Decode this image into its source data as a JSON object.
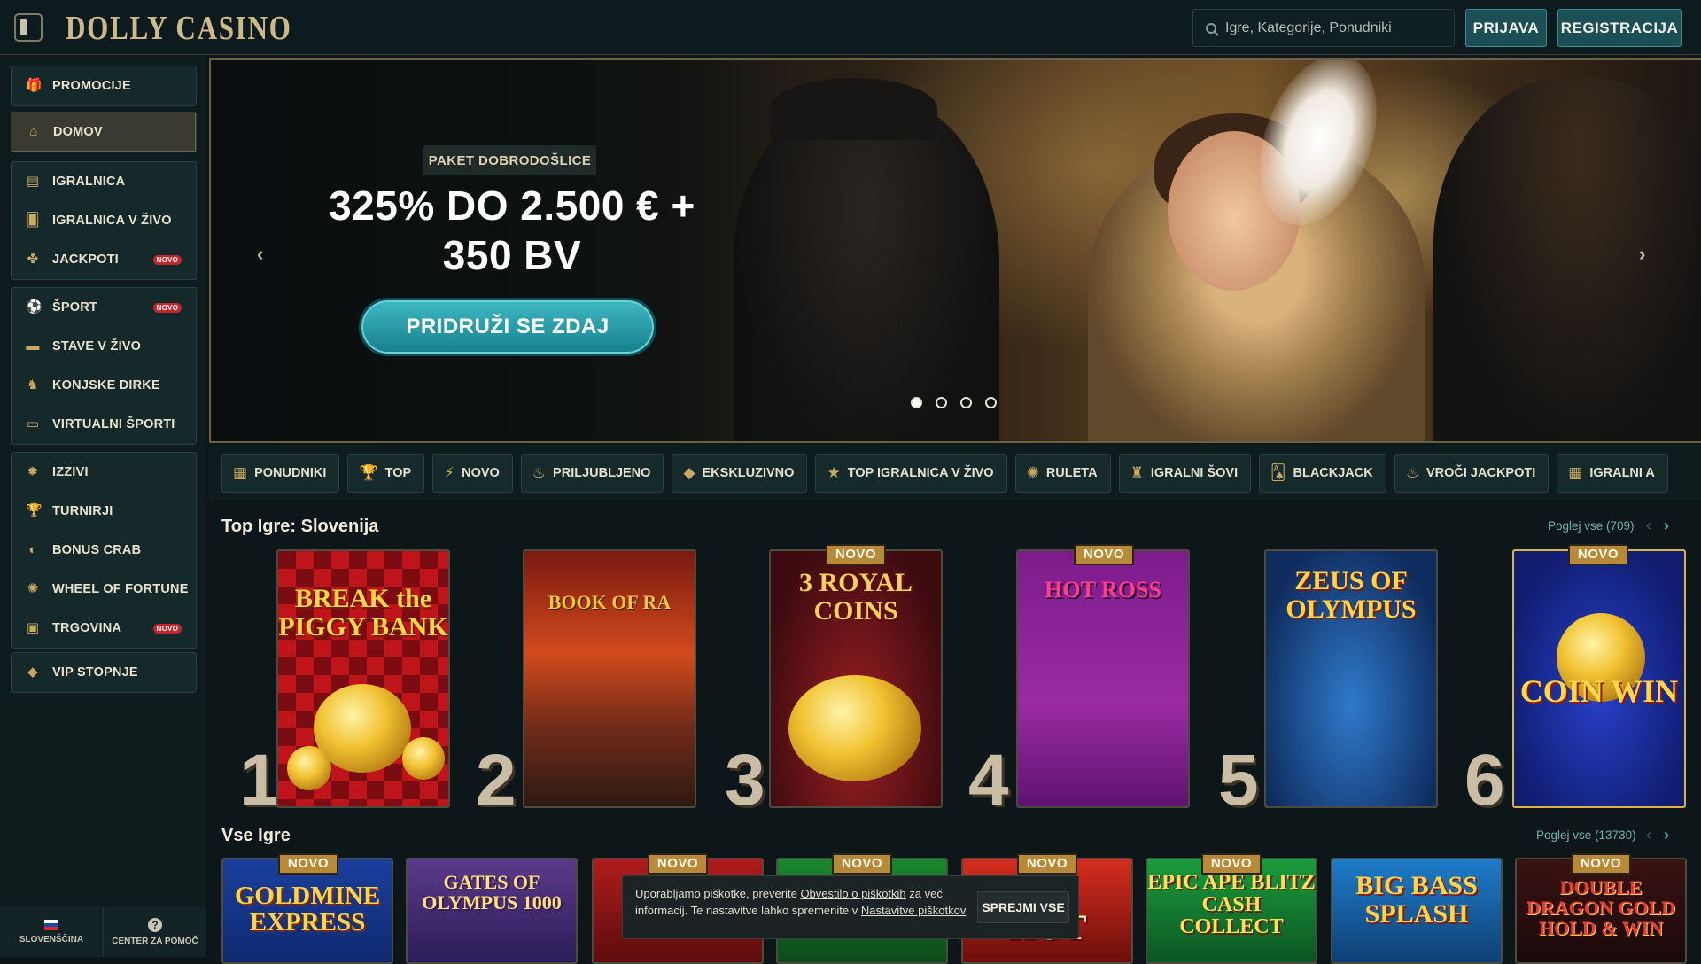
{
  "header": {
    "logo": "DOLLY CASINO",
    "search_placeholder": "Igre, Kategorije, Ponudniki",
    "login_label": "PRIJAVA",
    "register_label": "REGISTRACIJA"
  },
  "sidebar": {
    "promo": "PROMOCIJE",
    "home": "DOMOV",
    "casino": "IGRALNICA",
    "live_casino": "IGRALNICA V ŽIVO",
    "jackpots": "JACKPOTI",
    "sport": "ŠPORT",
    "live_bets": "STAVE V ŽIVO",
    "horse_racing": "KONJSKE DIRKE",
    "virtual_sports": "VIRTUALNI ŠPORTI",
    "challenges": "IZZIVI",
    "tournaments": "TURNIRJI",
    "bonus_crab": "BONUS CRAB",
    "wheel": "WHEEL OF FORTUNE",
    "shop": "TRGOVINA",
    "vip": "VIP STOPNJE",
    "novo_badge": "NOVO",
    "language": "SLOVENŠČINA",
    "help": "CENTER ZA POMOČ"
  },
  "hero": {
    "eyebrow": "PAKET DOBRODOŠLICE",
    "title_line1": "325% DO 2.500 € +",
    "title_line2": "350 BV",
    "cta": "PRIDRUŽI SE ZDAJ",
    "slide_count": 4,
    "active_slide": 1
  },
  "categories": [
    {
      "icon": "▦",
      "label": "PONUDNIKI"
    },
    {
      "icon": "🏆",
      "label": "TOP"
    },
    {
      "icon": "⚡",
      "label": "NOVO"
    },
    {
      "icon": "♨",
      "label": "PRILJUBLJENO"
    },
    {
      "icon": "◆",
      "label": "EKSKLUZIVNO"
    },
    {
      "icon": "★",
      "label": "TOP IGRALNICA V ŽIVO"
    },
    {
      "icon": "✺",
      "label": "RULETA"
    },
    {
      "icon": "♜",
      "label": "IGRALNI ŠOVI"
    },
    {
      "icon": "🂡",
      "label": "BLACKJACK"
    },
    {
      "icon": "♨",
      "label": "VROČI JACKPOTI"
    },
    {
      "icon": "▦",
      "label": "IGRALNI A"
    }
  ],
  "top_games": {
    "title": "Top Igre: Slovenija",
    "view_all": "Poglej vse (709)",
    "novo_tag": "NOVO",
    "games": [
      {
        "rank": "1",
        "name": "BREAK the PIGGY BANK"
      },
      {
        "rank": "2",
        "name": "BOOK OF RA"
      },
      {
        "rank": "3",
        "name": "3 ROYAL COINS"
      },
      {
        "rank": "4",
        "name": "HOT ROSS"
      },
      {
        "rank": "5",
        "name": "ZEUS OF OLYMPUS"
      },
      {
        "rank": "6",
        "name": "COIN WIN"
      }
    ]
  },
  "all_games": {
    "title": "Vse Igre",
    "view_all": "Poglej vse (13730)",
    "games": [
      {
        "name": "GOLDMINE EXPRESS"
      },
      {
        "name": "GATES OF OLYMPUS 1000"
      },
      {
        "name": ""
      },
      {
        "name": ""
      },
      {
        "name": "HOT"
      },
      {
        "name": "EPIC APE BLITZ CASH COLLECT"
      },
      {
        "name": "BIG BASS SPLASH"
      },
      {
        "name": "DOUBLE DRAGON GOLD HOLD & WIN"
      }
    ]
  },
  "cookie": {
    "text_1": "Uporabljamo piškotke, preverite",
    "link_1": "Obvestilo o piškotkih",
    "text_2": "za več informacij. Te nastavitve lahko spremenite v",
    "link_2": "Nastavitve piškotkov",
    "accept": "SPREJMI VSE"
  },
  "colors": {
    "accent_teal": "#1b4f55",
    "gold": "#c9a85f",
    "badge_red": "#c4262d",
    "background": "#0d1719"
  }
}
